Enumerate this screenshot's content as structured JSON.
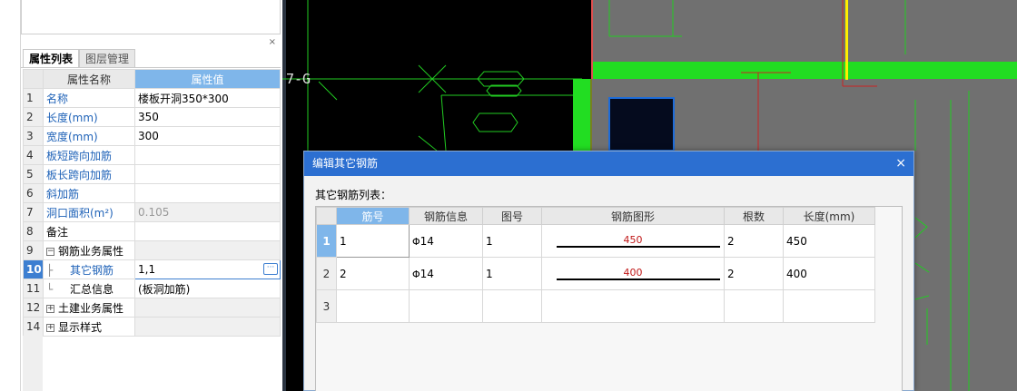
{
  "property_panel": {
    "tabs": [
      {
        "label": "属性列表",
        "active": true
      },
      {
        "label": "图层管理",
        "active": false
      }
    ],
    "close_glyph": "×",
    "columns": {
      "name": "属性名称",
      "value": "属性值"
    },
    "rows": [
      {
        "num": "1",
        "name": "名称",
        "value": "楼板开洞350*300"
      },
      {
        "num": "2",
        "name": "长度(mm)",
        "value": "350"
      },
      {
        "num": "3",
        "name": "宽度(mm)",
        "value": "300"
      },
      {
        "num": "4",
        "name": "板短跨向加筋",
        "value": ""
      },
      {
        "num": "5",
        "name": "板长跨向加筋",
        "value": ""
      },
      {
        "num": "6",
        "name": "斜加筋",
        "value": ""
      },
      {
        "num": "7",
        "name": "洞口面积(m²)",
        "value": "0.105"
      },
      {
        "num": "8",
        "name": "备注",
        "value": ""
      },
      {
        "num": "9",
        "name": "钢筋业务属性",
        "value": "",
        "expander": "−"
      },
      {
        "num": "10",
        "name": "其它钢筋",
        "value": "1,1"
      },
      {
        "num": "11",
        "name": "汇总信息",
        "value": "(板洞加筋)"
      },
      {
        "num": "12",
        "name": "土建业务属性",
        "value": "",
        "expander": "+"
      },
      {
        "num": "14",
        "name": "显示样式",
        "value": "",
        "expander": "+"
      }
    ],
    "edit_button_glyph": "···"
  },
  "cad": {
    "axis_label": "7-G",
    "colors": {
      "background": "#000000",
      "gray_area": "#707070",
      "green_beam": "#22dd22",
      "line_green": "#22cc22",
      "line_red": "#cc2222",
      "line_yellow": "#ffee00",
      "column_blue": "#1e6cd8"
    }
  },
  "dialog": {
    "title": "编辑其它钢筋",
    "close_glyph": "×",
    "list_label": "其它钢筋列表：",
    "columns": [
      "筋号",
      "钢筋信息",
      "图号",
      "钢筋图形",
      "根数",
      "长度(mm)"
    ],
    "rows": [
      {
        "row": "1",
        "bar_no": "1",
        "diameter": "14",
        "figure_no": "1",
        "shape_value": "450",
        "count": "2",
        "length": "450"
      },
      {
        "row": "2",
        "bar_no": "2",
        "diameter": "14",
        "figure_no": "1",
        "shape_value": "400",
        "count": "2",
        "length": "400"
      },
      {
        "row": "3",
        "bar_no": "",
        "diameter": "",
        "figure_no": "",
        "shape_value": "",
        "count": "",
        "length": ""
      }
    ],
    "grade_symbol": "Φ"
  }
}
